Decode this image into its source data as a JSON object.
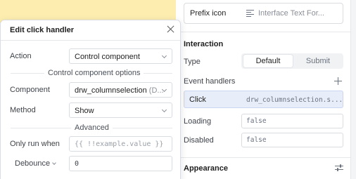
{
  "inspector": {
    "prefix_icon": {
      "label": "Prefix icon",
      "value": "Interface Text For...",
      "icon": "align-left-icon"
    },
    "interaction": {
      "title": "Interaction",
      "type_label": "Type",
      "type_options": [
        "Default",
        "Submit"
      ],
      "type_selected": "Default",
      "event_handlers_label": "Event handlers",
      "handler": {
        "event": "Click",
        "target": "drw_columnselection.s..."
      },
      "loading_label": "Loading",
      "loading_value": "false",
      "disabled_label": "Disabled",
      "disabled_value": "false"
    },
    "appearance": {
      "title": "Appearance",
      "icon": "sliders-icon"
    }
  },
  "modal": {
    "title": "Edit click handler",
    "action_label": "Action",
    "action_value": "Control component",
    "options_group_label": "Control component options",
    "component_label": "Component",
    "component_value": "drw_columnselection",
    "component_suffix": "(D...",
    "method_label": "Method",
    "method_value": "Show",
    "advanced_group_label": "Advanced",
    "only_run_label": "Only run when",
    "only_run_placeholder": "{{ !!example.value }}",
    "debounce_label": "Debounce",
    "debounce_value": "0"
  },
  "colors": {
    "canvas_strip": "#fdeeb0",
    "selected_handler_bg": "#e8eef9"
  }
}
